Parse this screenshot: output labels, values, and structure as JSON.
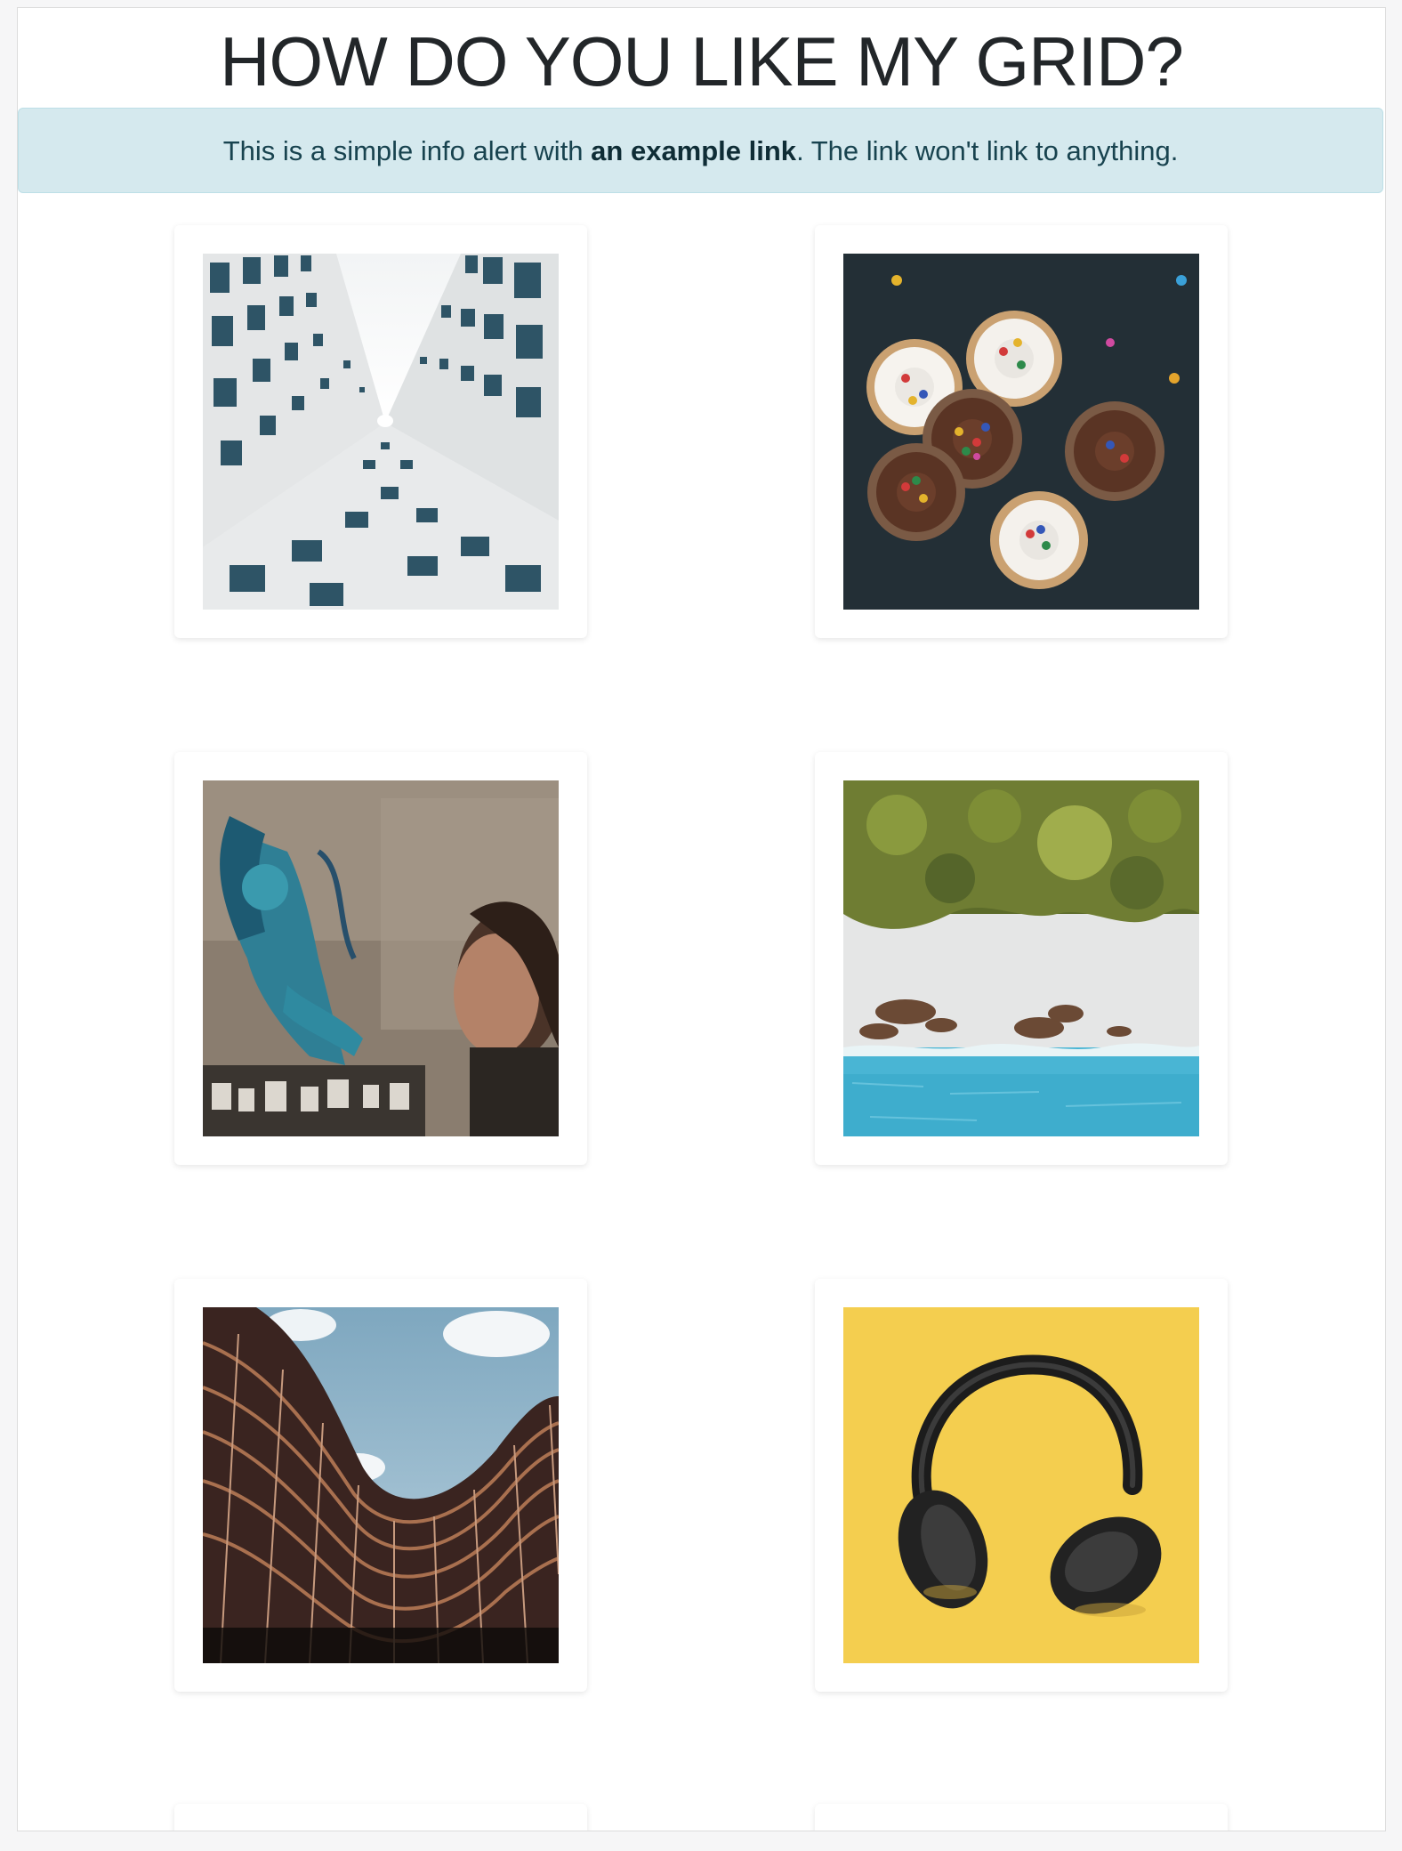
{
  "header": {
    "title": "HOW DO YOU LIKE MY GRID?"
  },
  "alert": {
    "text_before": "This is a simple info alert with ",
    "link_text": "an example link",
    "text_after": ". The link won't link to anything."
  },
  "gallery": {
    "photos": [
      {
        "subject": "tall white building facade viewed from below"
      },
      {
        "subject": "six cupcakes with sprinkles on dark surface"
      },
      {
        "subject": "blue mural painting on wall with woman in profile"
      },
      {
        "subject": "aerial view of palm trees, beach and turquoise sea"
      },
      {
        "subject": "curved brick building against cloudy sky"
      },
      {
        "subject": "black headphones on yellow background"
      }
    ]
  },
  "colors": {
    "alert_background": "#d5e9ee",
    "alert_text": "#18434f",
    "title_text": "#222629"
  }
}
